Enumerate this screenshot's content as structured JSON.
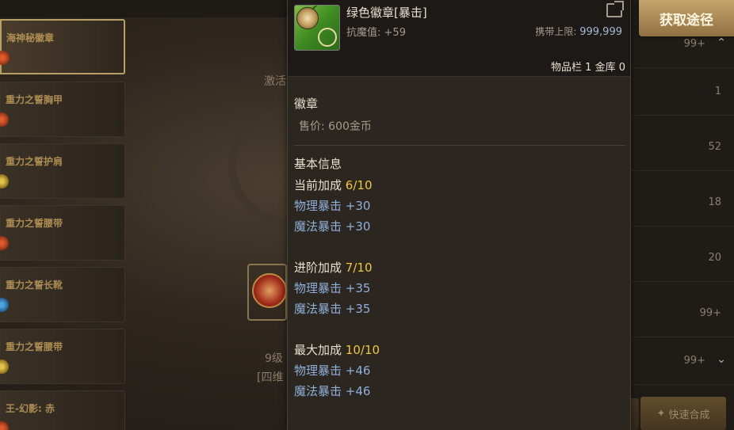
{
  "background": {
    "left_list": [
      {
        "label": "海神秘徽章",
        "icon": "red"
      },
      {
        "label": "重力之誓胸甲",
        "icon": "red"
      },
      {
        "label": "重力之誓护肩",
        "icon": "gold"
      },
      {
        "label": "重力之誓腰带",
        "icon": "red"
      },
      {
        "label": "重力之誓长靴",
        "icon": "blue"
      },
      {
        "label": "重力之誓腰带",
        "icon": "gold"
      },
      {
        "label": "王-幻影: 赤",
        "icon": "red"
      }
    ],
    "right_counts": [
      "99+",
      "1",
      "52",
      "18",
      "20",
      "99+",
      "99+"
    ],
    "center_texts": [
      "激活",
      "9级",
      "[四维"
    ],
    "quick_button_label": "快速合成"
  },
  "get_source_button": "获取途径",
  "tooltip": {
    "title": "绿色徽章[暴击]",
    "resist_label": "抗魔值:",
    "resist_value": "+59",
    "carry_label": "携带上限:",
    "carry_value": "999,999",
    "inventory": "物品栏 1 金库 0",
    "category": "徽章",
    "price": "售价: 600金币",
    "basic_info": "基本信息",
    "groups": [
      {
        "head_label": "当前加成",
        "head_value": "6/10",
        "stats": [
          "物理暴击 +30",
          "魔法暴击 +30"
        ]
      },
      {
        "head_label": "进阶加成",
        "head_value": "7/10",
        "stats": [
          "物理暴击 +35",
          "魔法暴击 +35"
        ]
      },
      {
        "head_label": "最大加成",
        "head_value": "10/10",
        "stats": [
          "物理暴击 +46",
          "魔法暴击 +46"
        ]
      }
    ]
  },
  "colors": {
    "stat_blue": "#8fb0d8",
    "highlight_yellow": "#f1c63a",
    "button_gold": "#c6a56d"
  }
}
